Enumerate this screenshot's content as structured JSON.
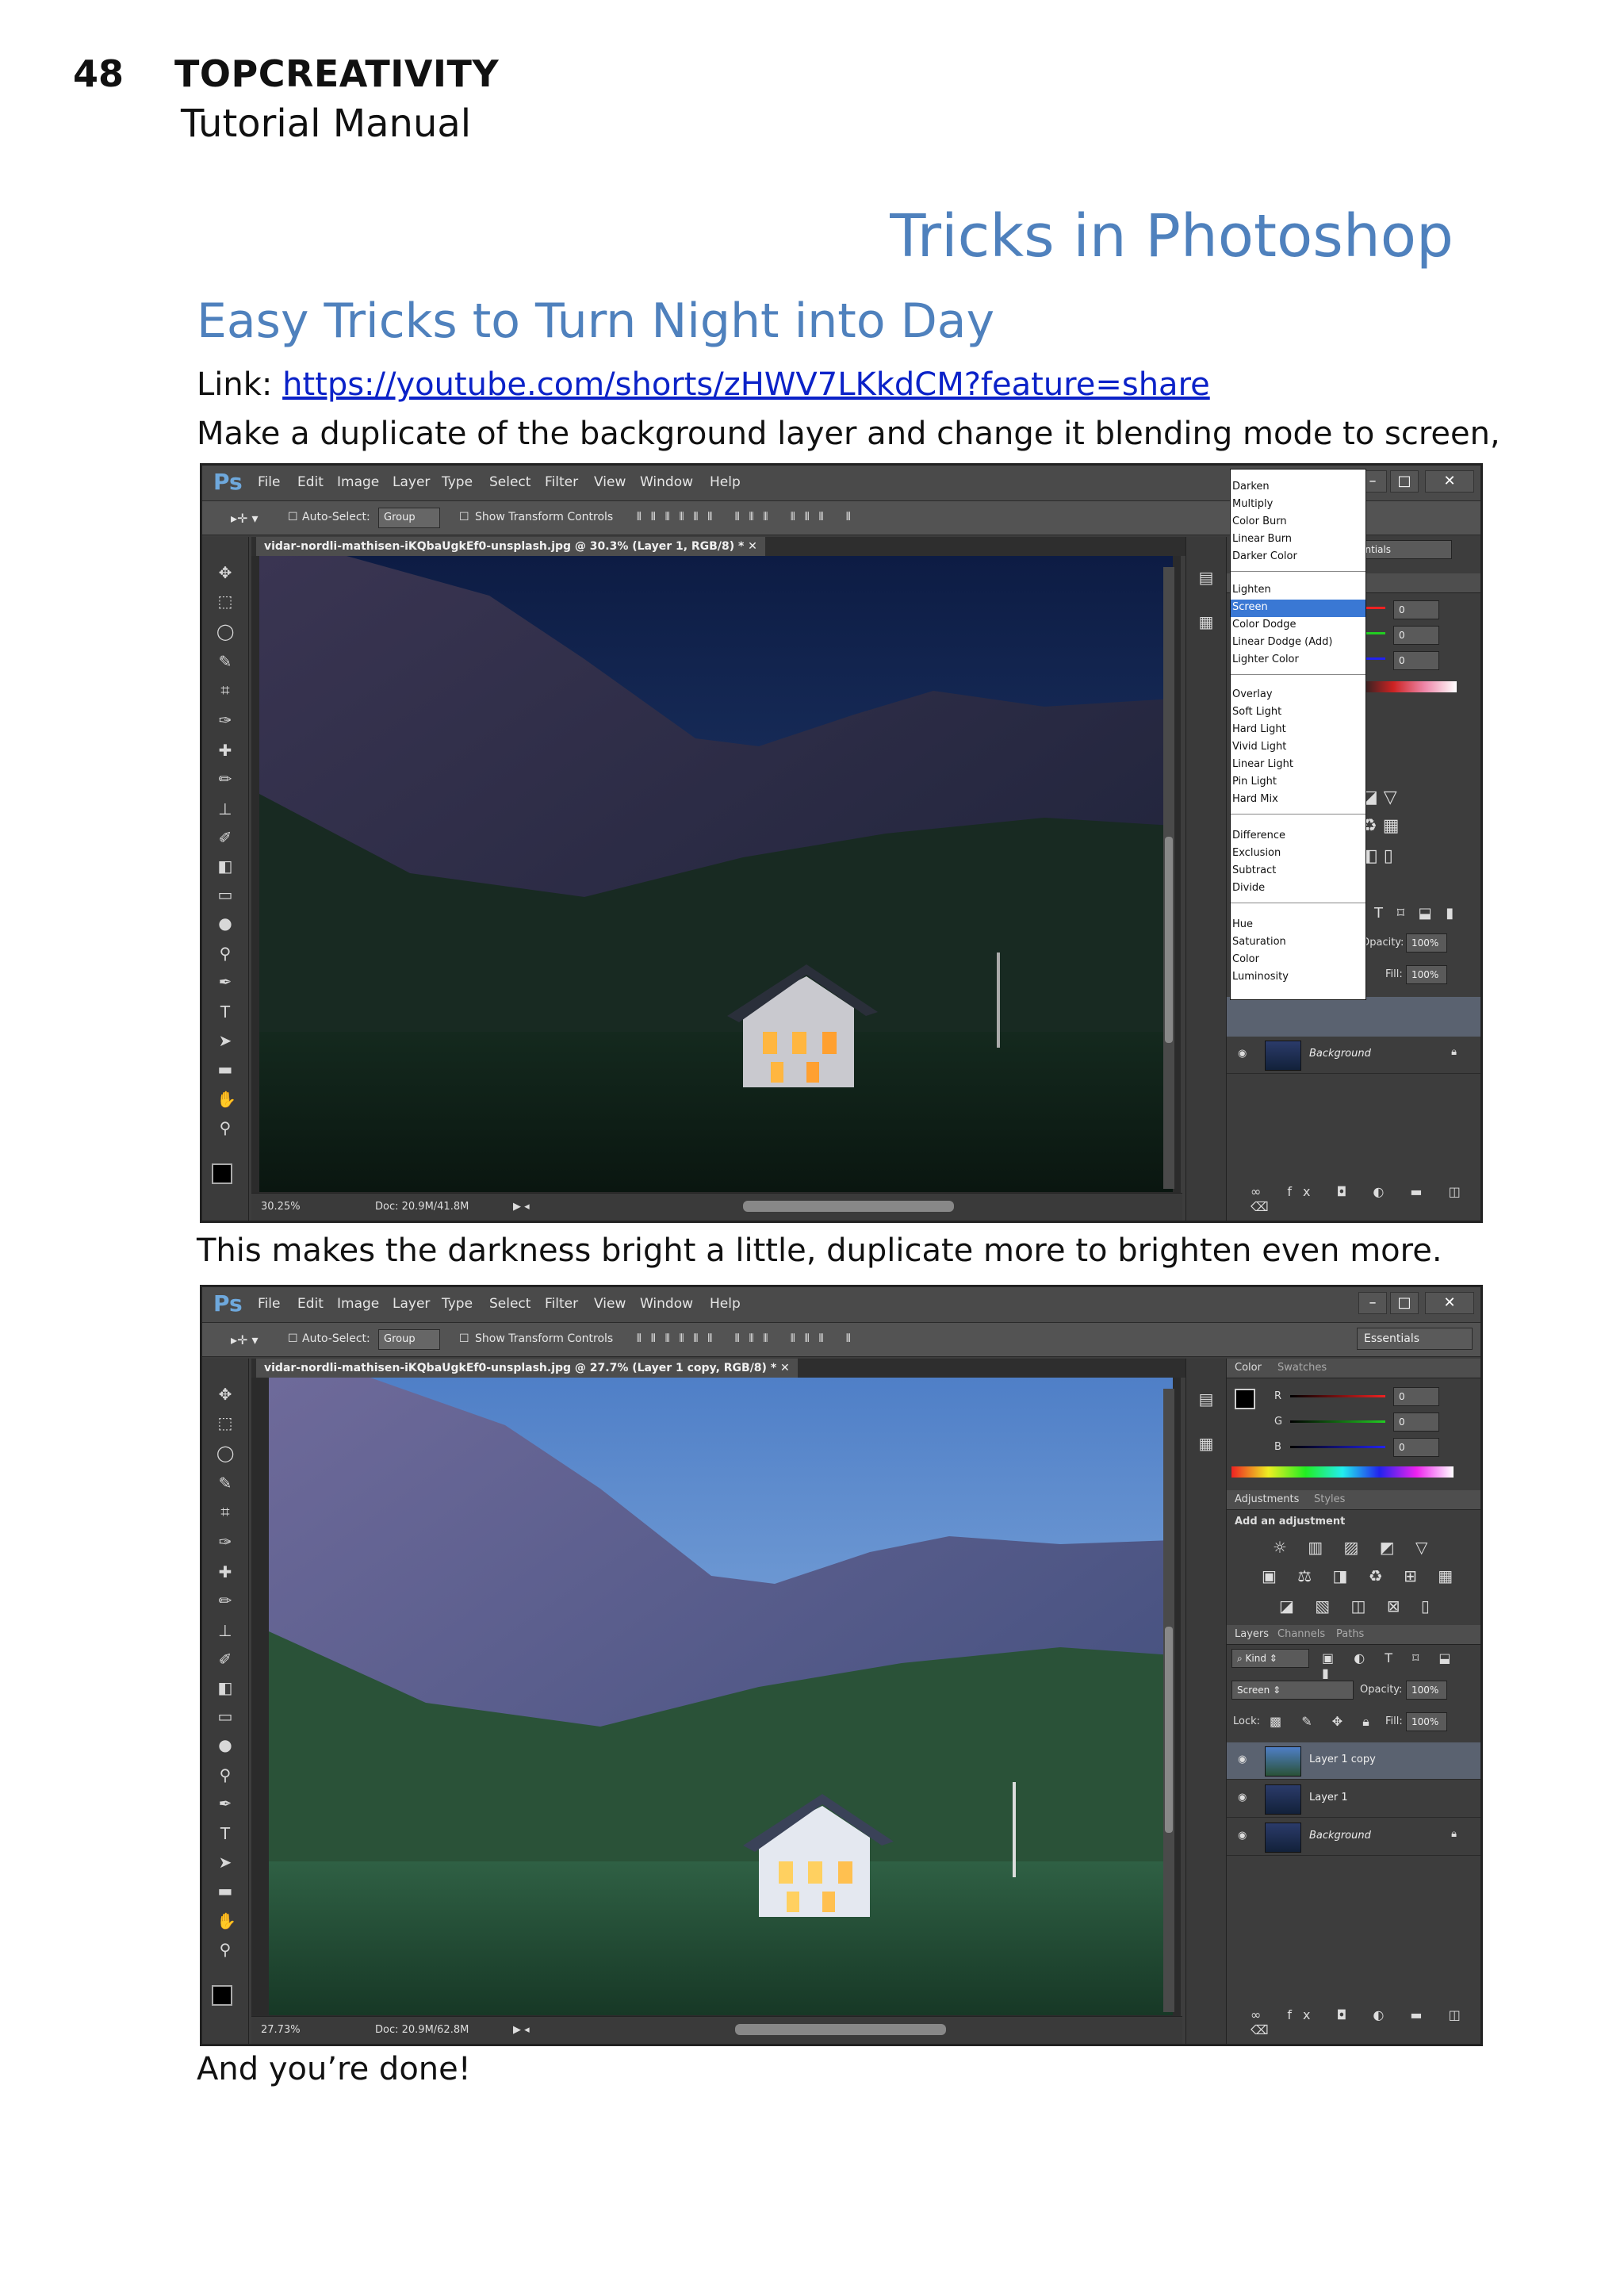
{
  "header": {
    "page_number": "48",
    "brand": "TOPCREATIVITY",
    "subtitle": "Tutorial Manual"
  },
  "section_title": "Tricks in Photoshop",
  "article": {
    "title": "Easy Tricks to Turn Night into Day",
    "link_label": "Link:",
    "link_url": "https://youtube.com/shorts/zHWV7LKkdCM?feature=share",
    "step1": "Make a duplicate of the background layer and change it blending mode to screen,",
    "step2": "This makes the darkness bright a little, duplicate more to brighten even more.",
    "step3": "And you’re done!"
  },
  "ps_common": {
    "logo": "Ps",
    "menu": [
      "File",
      "Edit",
      "Image",
      "Layer",
      "Type",
      "Select",
      "Filter",
      "View",
      "Window",
      "Help"
    ],
    "auto_select": "Auto-Select:",
    "group": "Group",
    "show_transform": "Show Transform Controls",
    "workspace": "Essentials"
  },
  "shot1": {
    "doc_tab": "vidar-nordli-mathisen-iKQbaUgkEf0-unsplash.jpg @ 30.3% (Layer 1, RGB/8) *",
    "zoom": "30.25%",
    "doc_size": "Doc: 20.9M/41.8M",
    "rgb_values": [
      "0",
      "0",
      "0"
    ],
    "opacity_label": "Opacity:",
    "opacity": "100%",
    "fill_label": "Fill:",
    "fill": "100%",
    "background_layer": "Background",
    "blend_groups": [
      [
        "Darken",
        "Multiply",
        "Color Burn",
        "Linear Burn",
        "Darker Color"
      ],
      [
        "Lighten",
        "Screen",
        "Color Dodge",
        "Linear Dodge (Add)",
        "Lighter Color"
      ],
      [
        "Overlay",
        "Soft Light",
        "Hard Light",
        "Vivid Light",
        "Linear Light",
        "Pin Light",
        "Hard Mix"
      ],
      [
        "Difference",
        "Exclusion",
        "Subtract",
        "Divide"
      ],
      [
        "Hue",
        "Saturation",
        "Color",
        "Luminosity"
      ]
    ],
    "selected_blend": "Screen"
  },
  "shot2": {
    "doc_tab": "vidar-nordli-mathisen-iKQbaUgkEf0-unsplash.jpg @ 27.7% (Layer 1 copy, RGB/8) *",
    "zoom": "27.73%",
    "doc_size": "Doc: 20.9M/62.8M",
    "color_tab": "Color",
    "swatches_tab": "Swatches",
    "r_label": "R",
    "g_label": "G",
    "b_label": "B",
    "rgb_values": [
      "0",
      "0",
      "0"
    ],
    "adjustments_tab": "Adjustments",
    "styles_tab": "Styles",
    "add_adjustment": "Add an adjustment",
    "layers_tab": "Layers",
    "channels_tab": "Channels",
    "paths_tab": "Paths",
    "kind": "Kind",
    "blend_mode": "Screen",
    "opacity_label": "Opacity:",
    "opacity": "100%",
    "lock_label": "Lock:",
    "fill_label": "Fill:",
    "fill": "100%",
    "layers": [
      "Layer 1 copy",
      "Layer 1",
      "Background"
    ]
  }
}
